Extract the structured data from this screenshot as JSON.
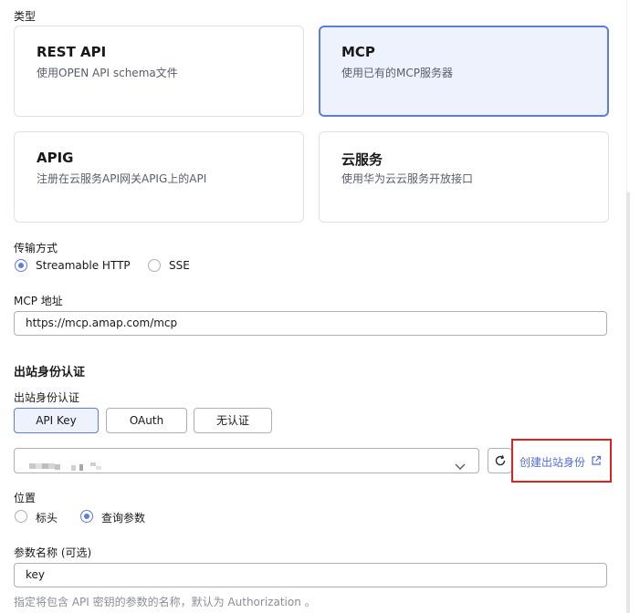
{
  "type_label": "类型",
  "cards": [
    {
      "title": "REST API",
      "desc": "使用OPEN API schema文件"
    },
    {
      "title": "MCP",
      "desc": "使用已有的MCP服务器"
    },
    {
      "title": "APIG",
      "desc": "注册在云服务API网关APIG上的API"
    },
    {
      "title": "云服务",
      "desc": "使用华为云云服务开放接口"
    }
  ],
  "transport": {
    "label": "传输方式",
    "options": [
      "Streamable HTTP",
      "SSE"
    ],
    "selected": "Streamable HTTP"
  },
  "mcp_address": {
    "label": "MCP 地址",
    "value": "https://mcp.amap.com/mcp"
  },
  "outbound": {
    "section_title": "出站身份认证",
    "label": "出站身份认证",
    "options": [
      "API Key",
      "OAuth",
      "无认证"
    ],
    "selected": "API Key",
    "create_link": "创建出站身份"
  },
  "position": {
    "label": "位置",
    "options": [
      "标头",
      "查询参数"
    ],
    "selected": "查询参数"
  },
  "param_name": {
    "label": "参数名称 (可选)",
    "value": "key",
    "hint": "指定将包含 API 密钥的参数的名称，默认为 Authorization 。"
  },
  "colors": {
    "accent": "#5e7ce0",
    "link": "#526ecc",
    "highlight_box": "#e02020"
  }
}
